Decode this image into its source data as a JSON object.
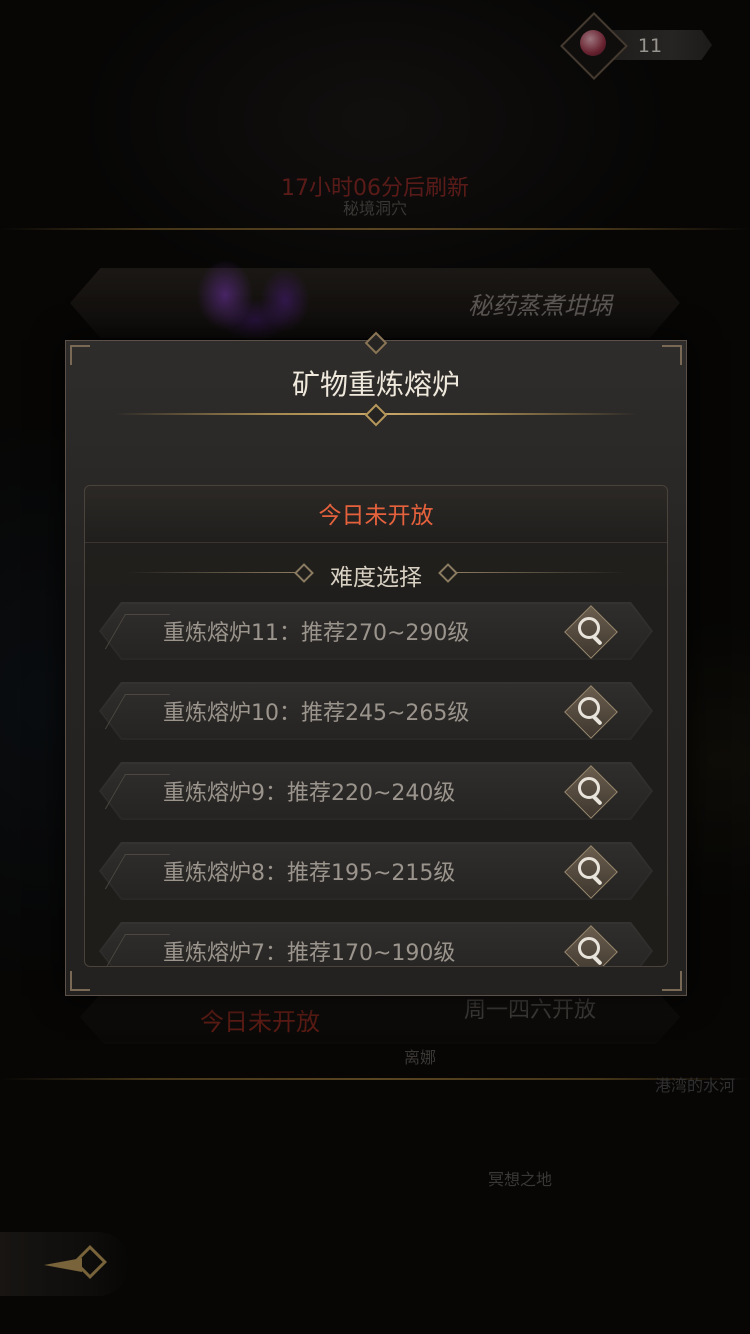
{
  "resource": {
    "count": "11",
    "icon": "gem-icon"
  },
  "background": {
    "refresh_text": "17小时06分后刷新",
    "location_top": "秘境洞穴",
    "card_title": "秘药蒸煮坩埚",
    "closed_label": "今日未开放",
    "open_days": "周一四六开放",
    "location_mid": "离娜",
    "location_right": "港湾的水河",
    "location_bottom": "冥想之地"
  },
  "modal": {
    "title": "矿物重炼熔炉",
    "status": "今日未开放",
    "section_title": "难度选择",
    "levels": [
      {
        "label": "重炼熔炉11：推荐270~290级"
      },
      {
        "label": "重炼熔炉10：推荐245~265级"
      },
      {
        "label": "重炼熔炉9：推荐220~240级"
      },
      {
        "label": "重炼熔炉8：推荐195~215级"
      },
      {
        "label": "重炼熔炉7：推荐170~190级"
      }
    ]
  },
  "colors": {
    "accent_red": "#e5623d",
    "gold": "#b8985a"
  }
}
